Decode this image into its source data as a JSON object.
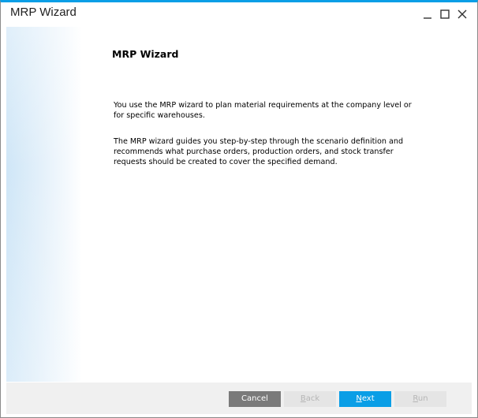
{
  "window": {
    "title": "MRP Wizard",
    "accent_color": "#0a9ee6"
  },
  "title_controls": {
    "icons": [
      "minimize-icon",
      "maximize-icon",
      "close-icon"
    ]
  },
  "page": {
    "heading": "MRP Wizard",
    "paragraph_1": "You use the MRP wizard to plan material requirements at the company level or for specific warehouses.",
    "paragraph_2": "The MRP wizard guides you step-by-step through the scenario definition and recommends what purchase orders, production orders, and stock transfer requests should be created to cover the specified demand."
  },
  "footer": {
    "cancel": {
      "label": "Cancel",
      "enabled": true
    },
    "back": {
      "label_first": "B",
      "label_rest": "ack",
      "enabled": false
    },
    "next": {
      "label_first": "N",
      "label_rest": "ext",
      "enabled": true
    },
    "run": {
      "label_first": "R",
      "label_rest": "un",
      "enabled": false
    }
  }
}
